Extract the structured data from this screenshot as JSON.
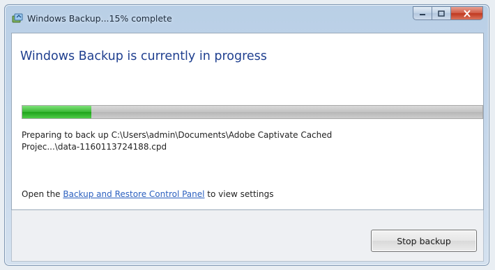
{
  "window": {
    "title": "Windows Backup...15% complete",
    "icon": "windows-backup-icon"
  },
  "caption_buttons": {
    "minimize_icon": "minimize-icon",
    "maximize_icon": "maximize-icon",
    "close_icon": "close-icon",
    "close_color": "#c8402a"
  },
  "main": {
    "heading": "Windows Backup is currently in progress",
    "progress_percent": 15,
    "progress_color": "#2fb52a",
    "status_line1": "Preparing to back up  C:\\Users\\admin\\Documents\\Adobe Captivate Cached",
    "status_line2": "Projec...\\data-1160113724188.cpd",
    "settings_prefix": "Open the ",
    "settings_link": "Backup and Restore Control Panel",
    "settings_suffix": " to view settings"
  },
  "footer": {
    "stop_button": "Stop backup"
  }
}
